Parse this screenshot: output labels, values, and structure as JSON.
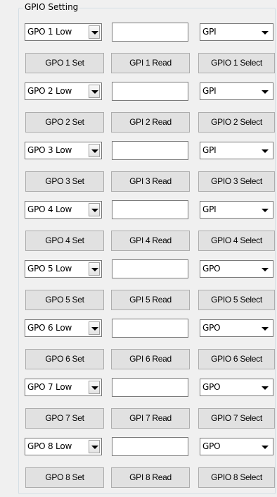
{
  "group": {
    "title": "GPIO Setting"
  },
  "rows": [
    {
      "gpo_level": "GPO 1 Low",
      "edit_value": "",
      "mode": "GPI",
      "set_label": "GPO 1 Set",
      "read_label": "GPI 1 Read",
      "select_label": "GPIO 1 Select"
    },
    {
      "gpo_level": "GPO 2 Low",
      "edit_value": "",
      "mode": "GPI",
      "set_label": "GPO 2 Set",
      "read_label": "GPI 2 Read",
      "select_label": "GPIO 2 Select"
    },
    {
      "gpo_level": "GPO 3 Low",
      "edit_value": "",
      "mode": "GPI",
      "set_label": "GPO 3 Set",
      "read_label": "GPI 3 Read",
      "select_label": "GPIO 3 Select"
    },
    {
      "gpo_level": "GPO 4 Low",
      "edit_value": "",
      "mode": "GPI",
      "set_label": "GPO 4 Set",
      "read_label": "GPI 4 Read",
      "select_label": "GPIO 4 Select"
    },
    {
      "gpo_level": "GPO 5 Low",
      "edit_value": "",
      "mode": "GPO",
      "set_label": "GPO 5 Set",
      "read_label": "GPI 5 Read",
      "select_label": "GPIO 5 Select"
    },
    {
      "gpo_level": "GPO 6 Low",
      "edit_value": "",
      "mode": "GPO",
      "set_label": "GPO 6 Set",
      "read_label": "GPI 6 Read",
      "select_label": "GPIO 6 Select"
    },
    {
      "gpo_level": "GPO 7 Low",
      "edit_value": "",
      "mode": "GPO",
      "set_label": "GPO 7 Set",
      "read_label": "GPI 7 Read",
      "select_label": "GPIO 7 Select"
    },
    {
      "gpo_level": "GPO 8 Low",
      "edit_value": "",
      "mode": "GPO",
      "set_label": "GPO 8 Set",
      "read_label": "GPI 8 Read",
      "select_label": "GPIO 8 Select"
    }
  ],
  "icons": {
    "dropdown": "chevron-down-icon"
  }
}
